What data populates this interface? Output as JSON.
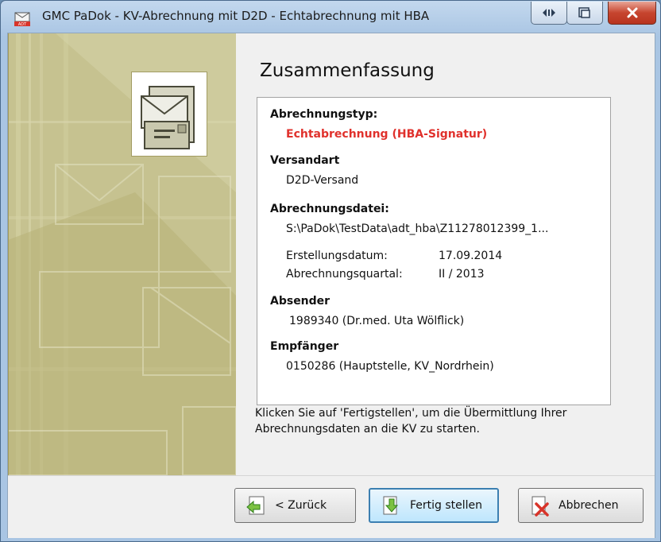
{
  "window": {
    "title": "GMC PaDok  -  KV-Abrechnung mit D2D  -  Echtabrechnung mit HBA"
  },
  "page": {
    "heading": "Zusammenfassung"
  },
  "summary": {
    "abrechnungstyp_label": "Abrechnungstyp:",
    "abrechnungstyp_value": "Echtabrechnung (HBA-Signatur)",
    "versandart_label": "Versandart",
    "versandart_value": "D2D-Versand",
    "datei_label": "Abrechnungsdatei:",
    "datei_value": "S:\\PaDok\\TestData\\adt_hba\\Z11278012399_1...",
    "erstellungsdatum_label": "Erstellungsdatum:",
    "erstellungsdatum_value": "17.09.2014",
    "quartal_label": "Abrechnungsquartal:",
    "quartal_value": "II / 2013",
    "absender_label": "Absender",
    "absender_value": "1989340  (Dr.med. Uta Wölflick)",
    "empfaenger_label": "Empfänger",
    "empfaenger_value": "0150286  (Hauptstelle, KV_Nordrhein)"
  },
  "footer": {
    "hint": "Klicken Sie auf 'Fertigstellen', um die Übermittlung Ihrer Abrechnungsdaten an die KV zu starten."
  },
  "buttons": {
    "back": "< Zurück",
    "finish": "Fertig stellen",
    "cancel": "Abbrechen"
  },
  "icons": {
    "app": "adt-app-icon",
    "side": "envelope-letter-icon",
    "back": "arrow-left-icon",
    "finish": "document-arrow-down-icon",
    "cancel": "document-red-x-icon"
  },
  "colors": {
    "accent_red": "#e0312c",
    "default_button_border": "#3c7fb1",
    "side_panel": "#c4c08a"
  }
}
